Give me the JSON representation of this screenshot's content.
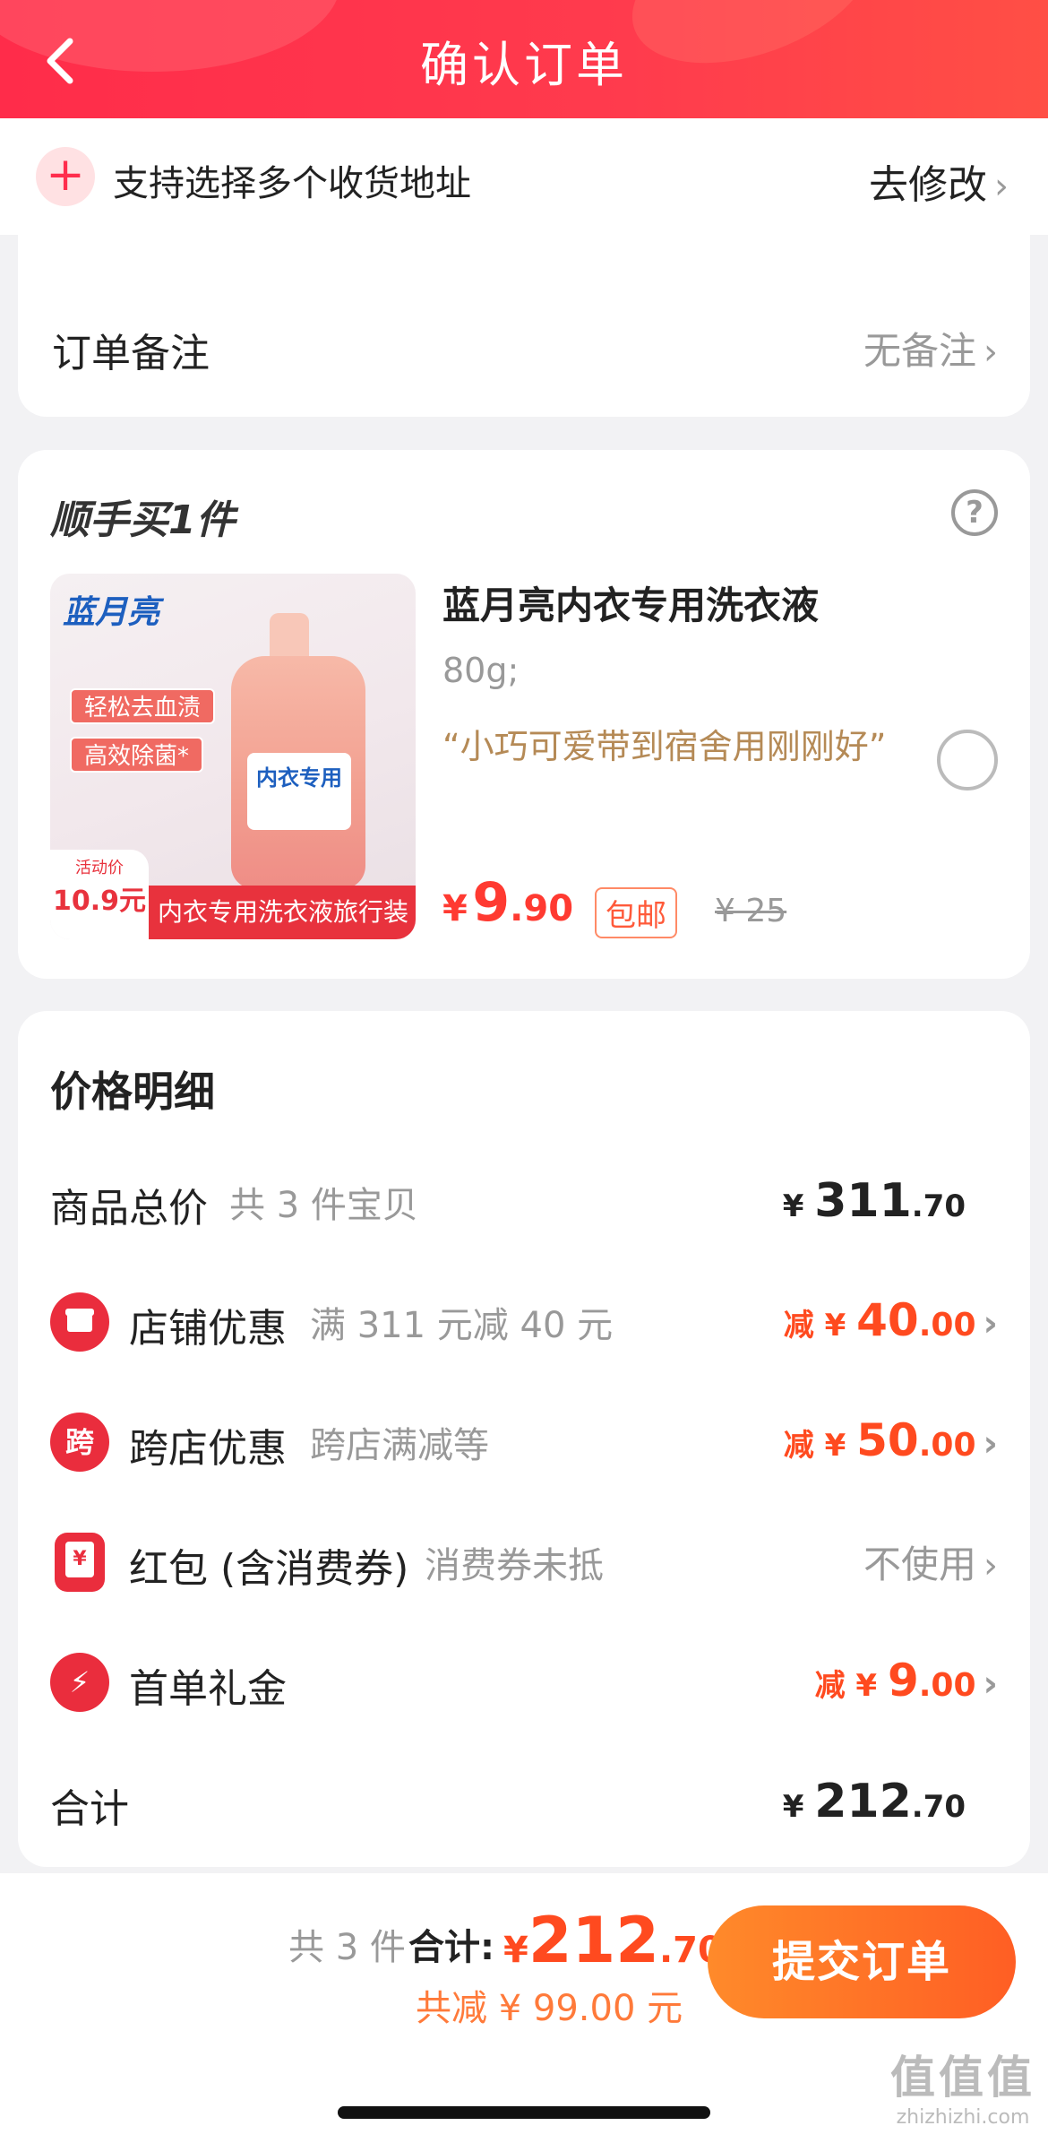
{
  "header": {
    "title": "确认订单"
  },
  "address_bar": {
    "label": "支持选择多个收货地址",
    "action": "去修改"
  },
  "note": {
    "label": "订单备注",
    "value": "无备注"
  },
  "addon": {
    "title": "顺手买1件",
    "product": {
      "name": "蓝月亮内衣专用洗衣液",
      "spec": "80g;",
      "quote": "“小巧可爱带到宿舍用刚刚好”",
      "price_currency": "¥",
      "price_int": "9",
      "price_dec": ".90",
      "free_shipping": "包邮",
      "orig_price": "¥ 25",
      "image": {
        "brand": "蓝月亮",
        "tag1": "轻松去血渍",
        "tag2": "高效除菌*",
        "badge_small": "活动价",
        "badge_price": "10.9元",
        "strip": "内衣专用洗衣液旅行装",
        "bottle_label": "内衣专用"
      }
    }
  },
  "detail": {
    "title": "价格明细",
    "rows": [
      {
        "label": "商品总价",
        "sub": "共 3 件宝贝",
        "prefix": "¥ ",
        "big": "311",
        "small": ".70",
        "style": "black"
      },
      {
        "icon": "店",
        "label": "店铺优惠",
        "sub": "满 311 元减 40 元",
        "prefix": "减 ¥ ",
        "big": "40",
        "small": ".00",
        "style": "red"
      },
      {
        "icon": "跨",
        "label": "跨店优惠",
        "sub": "跨店满减等",
        "prefix": "减 ¥ ",
        "big": "50",
        "small": ".00",
        "style": "red"
      },
      {
        "icon": "¥",
        "label": "红包 (含消费券)",
        "sub": "消费券未抵",
        "value": "不使用",
        "style": "grey"
      },
      {
        "icon": "⚡",
        "label": "首单礼金",
        "prefix": "减 ¥ ",
        "big": "9",
        "small": ".00",
        "style": "red"
      },
      {
        "label": "合计",
        "prefix": "¥ ",
        "big": "212",
        "small": ".70",
        "style": "black"
      }
    ]
  },
  "footer": {
    "count": "共 3 件",
    "sum_label": "合计:",
    "sum_currency": "¥",
    "sum_int": "212",
    "sum_dec": ".70",
    "saved": "共减 ¥ 99.00 元",
    "submit": "提交订单"
  },
  "watermark": {
    "big": "值值值",
    "small": "zhizhizhi.com"
  }
}
